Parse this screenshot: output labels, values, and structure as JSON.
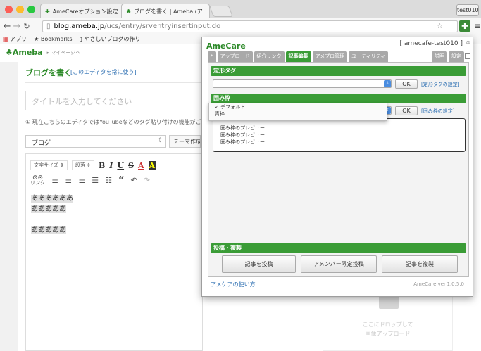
{
  "browser": {
    "tabs": [
      {
        "label": "AmeCareオプション設定"
      },
      {
        "label": "ブログを書く | Ameba (ア…"
      }
    ],
    "profile_name": "test010",
    "url_host": "blog.ameba.jp",
    "url_path": "/ucs/entry/srventryinsertinput.do",
    "bookmarks": [
      "アプリ",
      "Bookmarks",
      "やさしいブログの作り"
    ]
  },
  "page": {
    "logo": "Ameba",
    "breadcrumb": "マイページへ",
    "title": "ブログを書く",
    "editor_link": "[このエディタを常に使う]",
    "title_placeholder": "タイトルを入力してください",
    "notice": "① 現在こちらのエディタではYouTubeなどのタグ貼り付けの機能がご利",
    "category": "ブログ",
    "theme_button": "テーマ作成",
    "font_size_label": "文字サイズ",
    "paragraph_label": "段落",
    "link_label": "リンク",
    "body_lines": [
      "ああああああ",
      "あああああ",
      "",
      "あああああ"
    ],
    "upload_text": [
      "ここにドロップして",
      "画像アップロード"
    ]
  },
  "popup": {
    "title": "AmeCare",
    "user": "[ amecafe-test010 ]",
    "tabs": [
      "*",
      "アップロード",
      "紹介リンク",
      "記事編集",
      "アメプロ管理",
      "ユーティリティ"
    ],
    "active_tab": "記事編集",
    "right_tabs": [
      "説明",
      "設定"
    ],
    "section_template": "定形タグ",
    "template_link": "[定形タグの設定]",
    "section_frame": "囲み枠",
    "frame_link": "[囲み枠の設定]",
    "ok_label": "OK",
    "dropdown_options": [
      "✓ デフォルト",
      "青枠"
    ],
    "preview_lines": [
      "囲み枠のプレビュー",
      "囲み枠のプレビュー",
      "囲み枠のプレビュー"
    ],
    "section_post": "投稿・複製",
    "post_buttons": [
      "記事を投稿",
      "アメンバー限定投稿",
      "記事を複製"
    ],
    "help_link": "アメケアの使い方",
    "version": "AmeCare ver.1.0.5.0"
  }
}
